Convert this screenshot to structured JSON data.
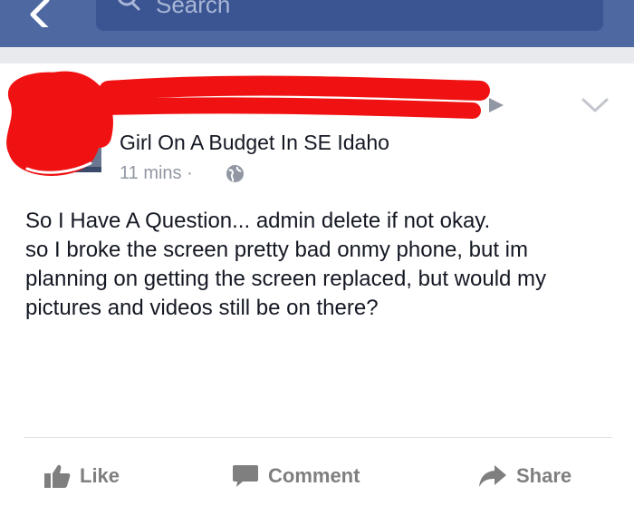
{
  "topbar": {
    "search_placeholder": "Search"
  },
  "post": {
    "group_name": "Girl On A Budget In SE Idaho",
    "timestamp": "11 mins",
    "separator": "·",
    "body_lines": [
      "So I Have A Question... admin delete if not okay.",
      "so I broke the screen pretty bad onmy phone, but im planning on getting the screen replaced, but would my pictures and videos still be on there?"
    ]
  },
  "actions": {
    "like_label": "Like",
    "comment_label": "Comment",
    "share_label": "Share"
  },
  "colors": {
    "brand_bar": "#4e69a2",
    "search_box": "#3b5593",
    "redaction": "#f01212",
    "action_text": "#7f7f7f"
  },
  "icons": [
    "back-icon",
    "search-icon",
    "chevron-down-icon",
    "group-arrow-icon",
    "globe-icon",
    "like-icon",
    "comment-icon",
    "share-icon"
  ]
}
